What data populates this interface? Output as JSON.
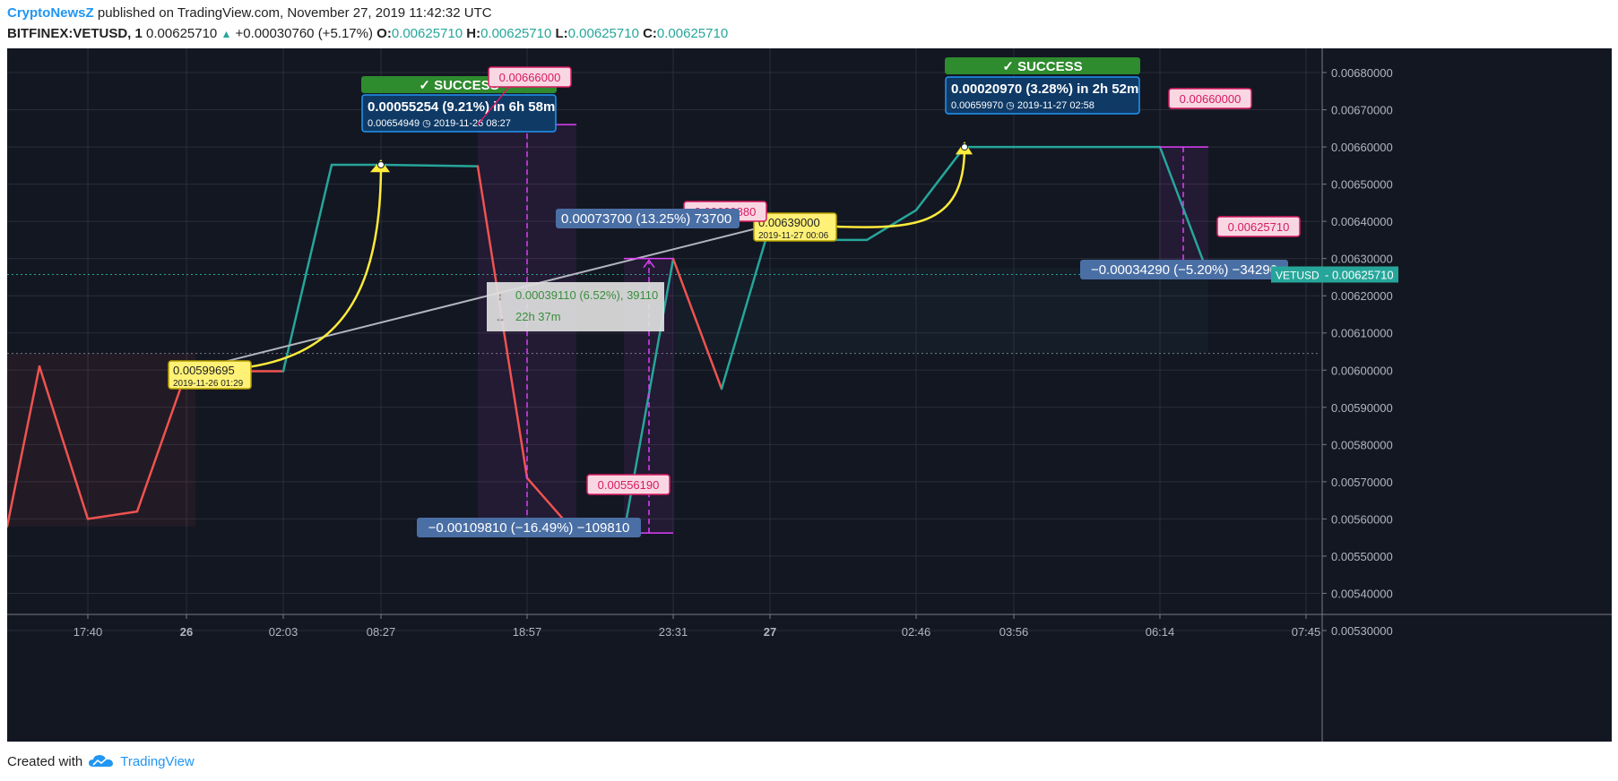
{
  "header": {
    "publisher": "CryptoNewsZ",
    "published_text": " published on TradingView.com, November 27, 2019 11:42:32 UTC",
    "symbol": "BITFINEX:VETUSD, 1",
    "last": "0.00625710",
    "change": "+0.00030760 (+5.17%)",
    "o_label": "O:",
    "o": "0.00625710",
    "h_label": "H:",
    "h": "0.00625710",
    "l_label": "L:",
    "l": "0.00625710",
    "c_label": "C:",
    "c": "0.00625710"
  },
  "footer": {
    "created_with": "Created with",
    "brand": "TradingView"
  },
  "colors": {
    "background": "#131722",
    "up_line": "#26a69a",
    "down_line": "#ef5350",
    "curve": "#ffeb3b",
    "magenta": "#e040fb",
    "blue_label": "#4a6fa5",
    "success_green": "#2e8b2e",
    "price_tag": "#26a69a"
  },
  "chart_data": {
    "type": "line",
    "title": "",
    "xlabel": "",
    "ylabel": "",
    "ylim": [
      0.00527,
      0.00685
    ],
    "y_ticks": [
      "0.00530000",
      "0.00540000",
      "0.00550000",
      "0.00560000",
      "0.00570000",
      "0.00580000",
      "0.00590000",
      "0.00600000",
      "0.00610000",
      "0.00620000",
      "0.00630000",
      "0.00640000",
      "0.00650000",
      "0.00660000",
      "0.00670000",
      "0.00680000"
    ],
    "x_ticks": [
      "17:40",
      "26",
      "02:03",
      "08:27",
      "18:57",
      "23:31",
      "27",
      "02:46",
      "03:56",
      "06:14",
      "07:45"
    ],
    "x_ticks_bold": [
      "26",
      "27"
    ],
    "series": [
      {
        "points": [
          [
            0.00558,
            "down"
          ],
          [
            0.00601,
            "down"
          ],
          [
            0.0056,
            "down"
          ],
          [
            0.00562,
            "down"
          ],
          [
            0.005997,
            "down"
          ],
          [
            0.005997,
            "down"
          ],
          [
            0.005997,
            "up"
          ],
          [
            0.006552,
            "up"
          ],
          [
            0.006552,
            "up"
          ],
          [
            0.006552,
            "up"
          ],
          [
            0.006548,
            "up"
          ],
          [
            0.006548,
            "down"
          ],
          [
            0.00571,
            "down"
          ],
          [
            0.005562,
            "down"
          ],
          [
            0.005562,
            "down"
          ],
          [
            0.006299,
            "up"
          ],
          [
            0.00595,
            "down"
          ],
          [
            0.00639,
            "up"
          ],
          [
            0.00635,
            "up"
          ],
          [
            0.00635,
            "up"
          ],
          [
            0.00643,
            "up"
          ],
          [
            0.0066,
            "up"
          ],
          [
            0.0066,
            "up"
          ],
          [
            0.0066,
            "up"
          ],
          [
            0.006257,
            "up"
          ]
        ]
      }
    ],
    "last_price_label": "VETUSD",
    "last_price_value": "0.00625710",
    "annotations": {
      "success_label": "✓ SUCCESS",
      "success1_stats": "0.00055254 (9.21%) in 6h 58m",
      "success1_sub": "0.00654949 ◷ 2019-11-26  08:27",
      "success2_stats": "0.00020970 (3.28%) in 2h 52m",
      "success2_sub": "0.00659970 ◷ 2019-11-27  02:58",
      "low_entry_price": "0.00599695",
      "low_entry_date": "2019-11-26 01:29",
      "mid_entry_price": "0.00639000",
      "mid_entry_date": "2019-11-27 00:06",
      "tag_high1": "0.00666000",
      "tag_mid": "0.00629880",
      "tag_low": "0.00556190",
      "tag_high2": "0.00660000",
      "tag_last": "0.00625710",
      "range_drop": "−0.00109810 (−16.49%) −109810",
      "range_rise": "0.00073700 (13.25%) 73700",
      "range_final": "−0.00034290 (−5.20%) −34290",
      "measure_value": "0.00039110 (6.52%), 39110",
      "measure_time": "22h 37m"
    }
  }
}
